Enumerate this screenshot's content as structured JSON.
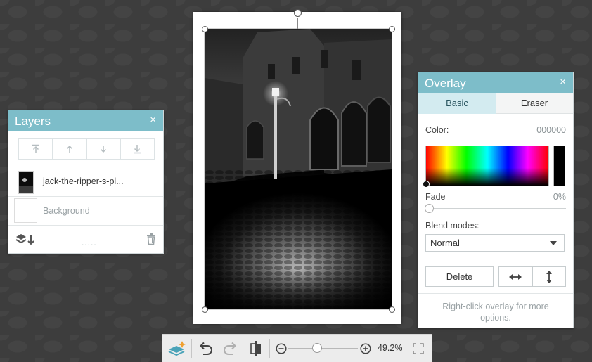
{
  "layers_panel": {
    "title": "Layers",
    "close": "×",
    "tools": [
      "move-to-top-icon",
      "move-up-icon",
      "move-down-icon",
      "move-to-bottom-icon"
    ],
    "layers": [
      {
        "name": "jack-the-ripper-s-pl...",
        "selected": true
      },
      {
        "name": "Background",
        "selected": false
      }
    ],
    "footer_handle": "....."
  },
  "overlay_panel": {
    "title": "Overlay",
    "close": "×",
    "tabs": [
      {
        "label": "Basic",
        "active": true
      },
      {
        "label": "Eraser",
        "active": false
      }
    ],
    "color_label": "Color:",
    "color_value": "000000",
    "fade_label": "Fade",
    "fade_value": "0%",
    "blend_label": "Blend modes:",
    "blend_selected": "Normal",
    "delete_label": "Delete",
    "hint": "Right-click overlay for more options.",
    "colors": {
      "header": "#7dbdc9",
      "active_tab": "#d3ebf0",
      "swatch": "#000000"
    }
  },
  "toolbar": {
    "zoom_level": "49.2%",
    "icons": [
      "layers-icon",
      "undo-icon",
      "redo-icon",
      "compare-icon",
      "zoom-out-icon",
      "zoom-in-icon",
      "fullscreen-icon"
    ]
  }
}
